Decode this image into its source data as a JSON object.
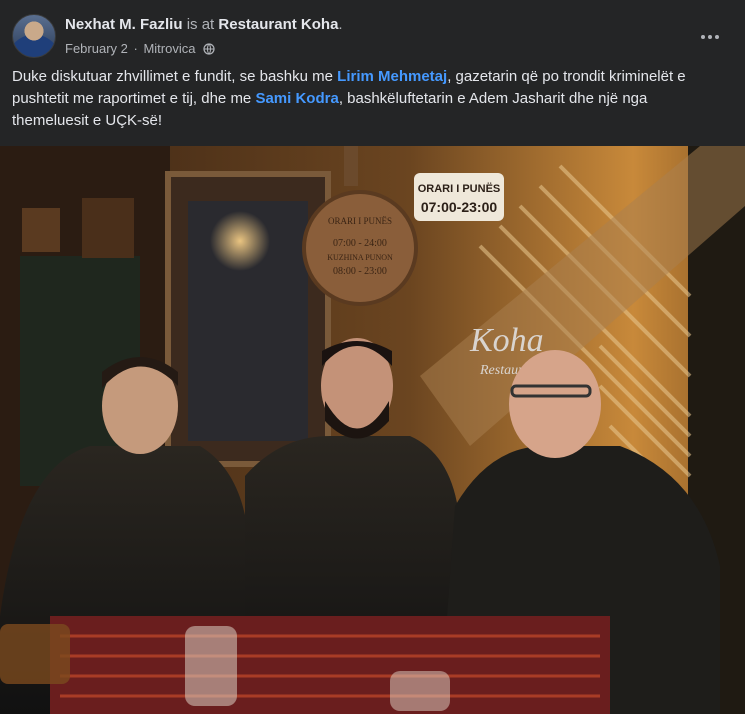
{
  "post": {
    "author": "Nexhat M. Fazliu",
    "connector": " is at ",
    "place": "Restaurant Koha",
    "place_suffix": ".",
    "date": "February 2",
    "separator": "·",
    "location": "Mitrovica",
    "privacy_icon": "globe-icon",
    "more_icon": "more-options-icon",
    "text": {
      "part1": "Duke diskutuar zhvillimet e fundit, se bashku me ",
      "mention1": "Lirim Mehmetaj",
      "part2": ", gazetarin që po trondit kriminelët e pushtetit me raportimet e tij, dhe me ",
      "mention2": "Sami Kodra",
      "part3": ", bashkëluftetarin e Adem Jasharit dhe një nga themeluesit e UÇK-së!"
    }
  },
  "photo": {
    "sign_small_title": "ORARI I PUNËS",
    "sign_small_hours": "07:00-23:00",
    "wood_sign_title": "ORARI I PUNËS",
    "wood_sign_line1": "07:00 - 24:00",
    "wood_sign_line2": "KUZHINA PUNON",
    "wood_sign_line3": "08:00 - 23:00",
    "logo_main": "Koha",
    "logo_sub": "Restaurant"
  },
  "colors": {
    "background": "#242526",
    "text": "#e4e6eb",
    "secondary_text": "#b0b3b8",
    "mention": "#4599ff"
  }
}
